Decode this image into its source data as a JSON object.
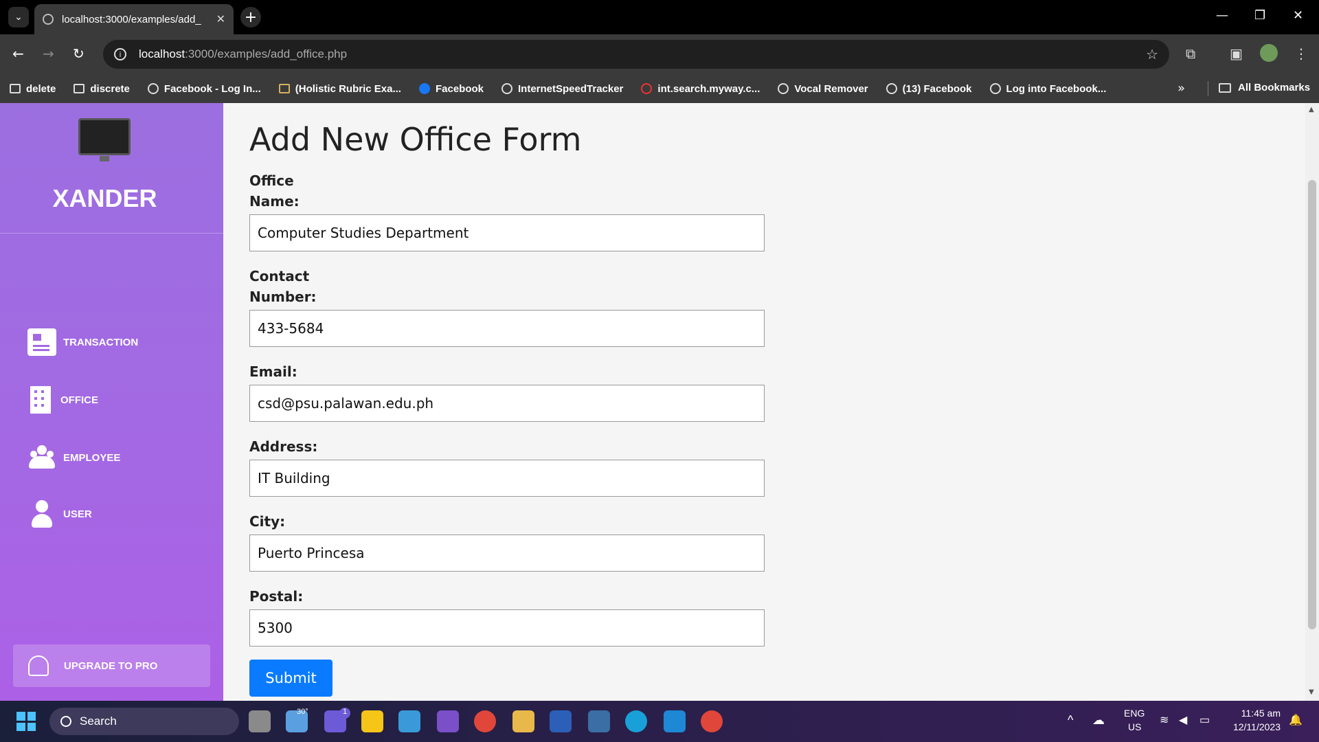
{
  "browser": {
    "tab_title": "localhost:3000/examples/add_office.php",
    "tab_title_short": "localhost:3000/examples/add_",
    "url_host": "localhost",
    "url_path": ":3000/examples/add_office.php",
    "bookmarks": [
      {
        "label": "delete",
        "icon": "folder-icon"
      },
      {
        "label": "discrete",
        "icon": "folder-icon"
      },
      {
        "label": "Facebook - Log In...",
        "icon": "globe-icon"
      },
      {
        "label": "(Holistic Rubric Exa...",
        "icon": "rubric-icon"
      },
      {
        "label": "Facebook",
        "icon": "facebook-icon"
      },
      {
        "label": "InternetSpeedTracker",
        "icon": "globe-icon"
      },
      {
        "label": "int.search.myway.c...",
        "icon": "ring-icon"
      },
      {
        "label": "Vocal Remover",
        "icon": "globe-icon"
      },
      {
        "label": "(13) Facebook",
        "icon": "globe-icon"
      },
      {
        "label": "Log into Facebook...",
        "icon": "globe-icon"
      }
    ],
    "all_bookmarks": "All Bookmarks"
  },
  "sidebar": {
    "brand": "XANDER",
    "items": [
      {
        "label": "TRANSACTION",
        "icon": "newspaper-icon"
      },
      {
        "label": "OFFICE",
        "icon": "building-icon"
      },
      {
        "label": "EMPLOYEE",
        "icon": "users-icon"
      },
      {
        "label": "USER",
        "icon": "user-icon"
      }
    ],
    "upgrade_label": "UPGRADE TO PRO"
  },
  "form": {
    "title": "Add New Office Form",
    "fields": [
      {
        "label": "Office Name:",
        "value": "Computer Studies Department"
      },
      {
        "label": "Contact Number:",
        "value": "433-5684"
      },
      {
        "label": "Email:",
        "value": "csd@psu.palawan.edu.ph"
      },
      {
        "label": "Address:",
        "value": "IT Building"
      },
      {
        "label": "City:",
        "value": "Puerto Princesa"
      },
      {
        "label": "Postal:",
        "value": "5300"
      }
    ],
    "submit_label": "Submit"
  },
  "taskbar": {
    "search_label": "Search",
    "weather_temp": "30°",
    "chat_badge": "1",
    "lang_1": "ENG",
    "lang_2": "US",
    "time": "11:45 am",
    "date": "12/11/2023"
  },
  "colors": {
    "sidebar_accent": "#a36ae3",
    "submit_button": "#0a7bff"
  }
}
